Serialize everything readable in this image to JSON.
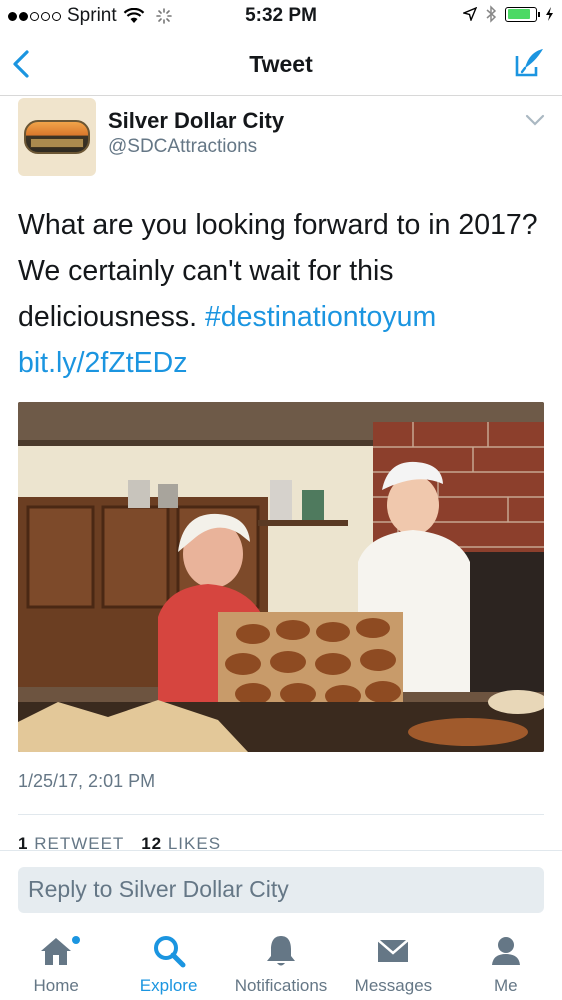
{
  "status_bar": {
    "carrier": "Sprint",
    "time": "5:32 PM",
    "battery_level": 0.85
  },
  "nav": {
    "title": "Tweet",
    "back_icon": "chevron-left-icon",
    "compose_icon": "compose-icon"
  },
  "tweet": {
    "name": "Silver Dollar City",
    "handle": "@SDCAttractions",
    "text_plain": "What are you looking forward to in 2017? We certainly can't wait for this deliciousness. ",
    "hashtag": "#destinationtoyum",
    "link": "bit.ly/2fZtEDz",
    "timestamp": "1/25/17, 2:01 PM",
    "retweets": "1",
    "retweets_label": "RETWEET",
    "likes": "12",
    "likes_label": "LIKES"
  },
  "reply": {
    "placeholder": "Reply to Silver Dollar City"
  },
  "tabs": [
    {
      "label": "Home",
      "icon": "home-icon"
    },
    {
      "label": "Explore",
      "icon": "search-icon",
      "active": true
    },
    {
      "label": "Notifications",
      "icon": "bell-icon"
    },
    {
      "label": "Messages",
      "icon": "envelope-icon"
    },
    {
      "label": "Me",
      "icon": "person-icon"
    }
  ],
  "colors": {
    "accent": "#1b95e0",
    "secondary_text": "#657786",
    "battery": "#4cd964"
  }
}
